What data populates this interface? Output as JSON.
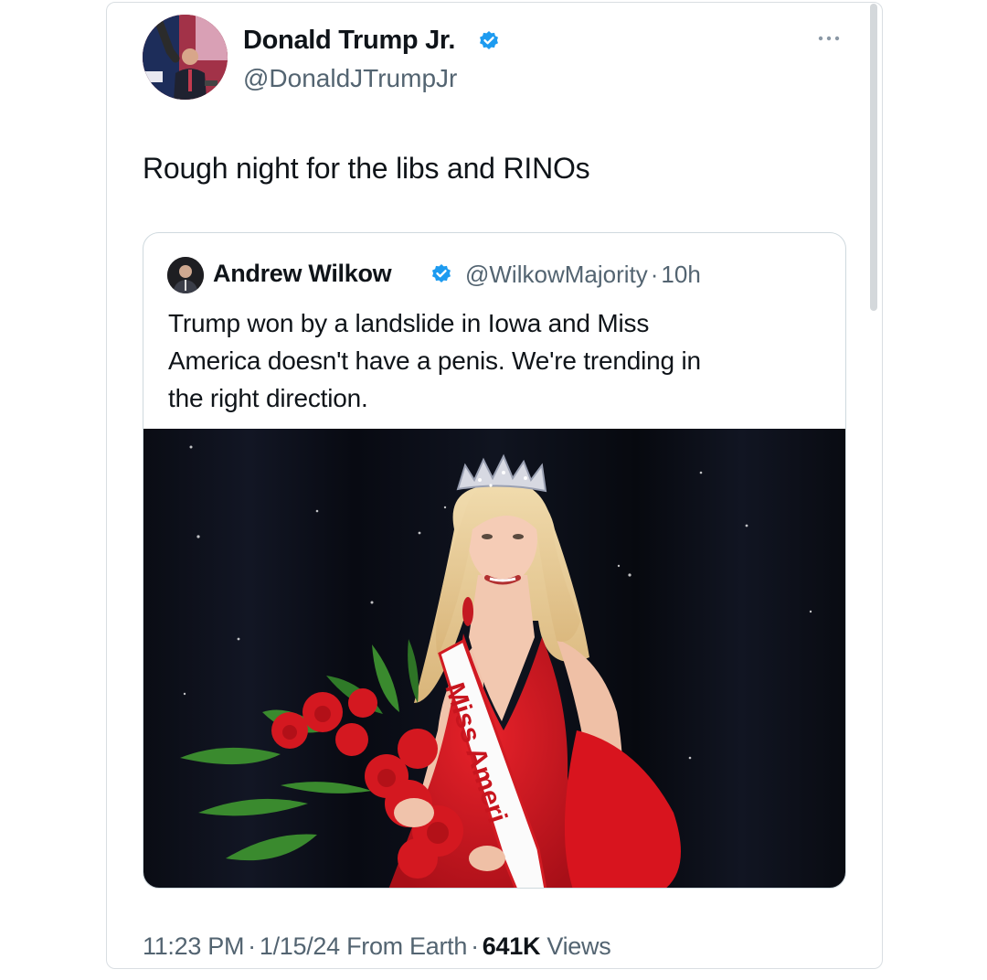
{
  "tweet": {
    "author_name": "Donald Trump Jr.",
    "author_handle": "@DonaldJTrumpJr",
    "text": "Rough night for the libs and RINOs",
    "time": "11:23 PM",
    "date": "1/15/24",
    "source": "From Earth",
    "views_count": "641K",
    "views_label": "Views"
  },
  "quoted": {
    "author_name": "Andrew Wilkow",
    "author_handle": "@WilkowMajority",
    "age": "10h",
    "text_lines": [
      "Trump won by a landslide in Iowa and Miss",
      "America doesn't have a penis. We're trending in",
      "the right direction."
    ],
    "sash_text": "Miss Ameri"
  },
  "icons": {
    "verified": "verified-badge-icon",
    "more": "more-options-icon"
  },
  "colors": {
    "verified_blue": "#1d9bf0",
    "secondary_text": "#536471",
    "border": "#cfd9de"
  },
  "separator": "·"
}
